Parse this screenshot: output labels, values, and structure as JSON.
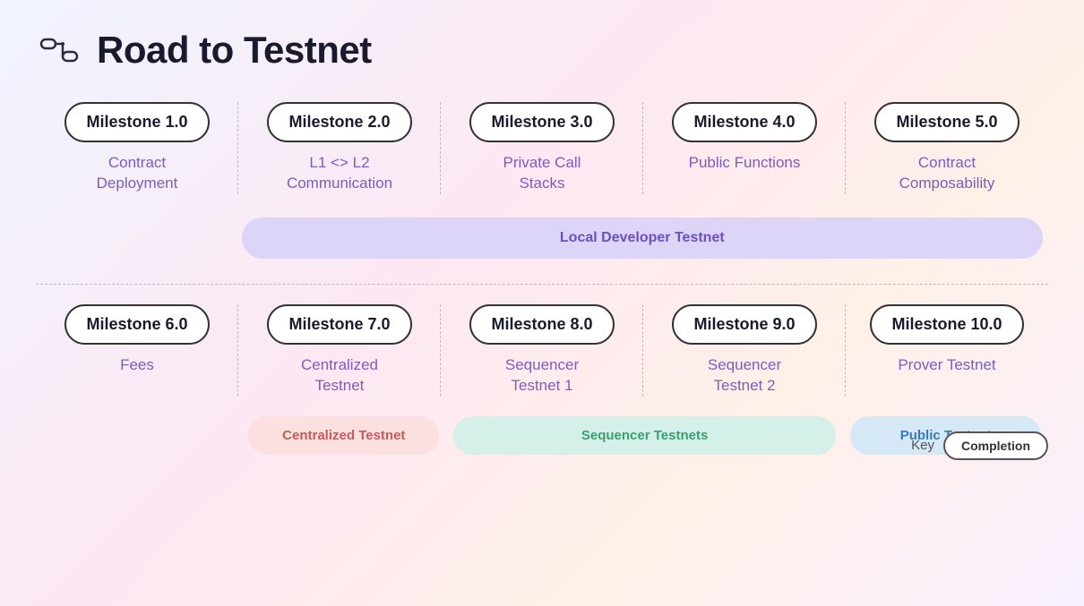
{
  "header": {
    "title": "Road to Testnet",
    "icon_label": "roadmap-icon"
  },
  "top_milestones": [
    {
      "id": "ms1",
      "badge": "Milestone 1.0",
      "label": "Contract\nDeployment"
    },
    {
      "id": "ms2",
      "badge": "Milestone 2.0",
      "label": "L1 <> L2\nCommunication"
    },
    {
      "id": "ms3",
      "badge": "Milestone 3.0",
      "label": "Private Call\nStacks"
    },
    {
      "id": "ms4",
      "badge": "Milestone 4.0",
      "label": "Public Functions"
    },
    {
      "id": "ms5",
      "badge": "Milestone 5.0",
      "label": "Contract\nComposability"
    }
  ],
  "local_dev_band": "Local Developer Testnet",
  "bottom_milestones": [
    {
      "id": "ms6",
      "badge": "Milestone 6.0",
      "label": "Fees"
    },
    {
      "id": "ms7",
      "badge": "Milestone 7.0",
      "label": "Centralized\nTestnet"
    },
    {
      "id": "ms8",
      "badge": "Milestone 8.0",
      "label": "Sequencer\nTestnet 1"
    },
    {
      "id": "ms9",
      "badge": "Milestone 9.0",
      "label": "Sequencer\nTestnet 2"
    },
    {
      "id": "ms10",
      "badge": "Milestone 10.0",
      "label": "Prover Testnet"
    }
  ],
  "bottom_bands": [
    {
      "id": "band-centralized",
      "label": "Centralized Testnet",
      "style": "pink",
      "span": 1,
      "start": 1
    },
    {
      "id": "band-sequencer",
      "label": "Sequencer Testnets",
      "style": "green",
      "span": 2,
      "start": 2
    },
    {
      "id": "band-public",
      "label": "Public Testnet",
      "style": "blue",
      "span": 1,
      "start": 4
    }
  ],
  "key": {
    "label": "Key",
    "pill": "Completion"
  }
}
